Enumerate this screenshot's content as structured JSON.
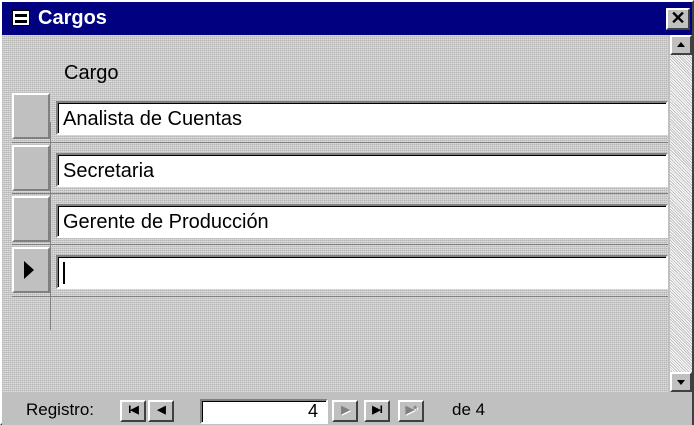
{
  "window": {
    "title": "Cargos",
    "close_label": "✕"
  },
  "form": {
    "column_header": "Cargo",
    "records": [
      {
        "value": "Analista de Cuentas"
      },
      {
        "value": "Secretaria"
      },
      {
        "value": "Gerente de Producción"
      },
      {
        "value": ""
      }
    ],
    "current_record_indicator": "new-record-pointer"
  },
  "navigation": {
    "label": "Registro:",
    "first_label": "I◀",
    "prev_label": "◀",
    "current_record": "4",
    "next_label": "▶",
    "last_label": "▶I",
    "new_label": "▶*",
    "total_text": "de 4"
  },
  "colors": {
    "titlebar": "#000080",
    "face": "#c0c0c0",
    "field_bg": "#ffffff"
  }
}
